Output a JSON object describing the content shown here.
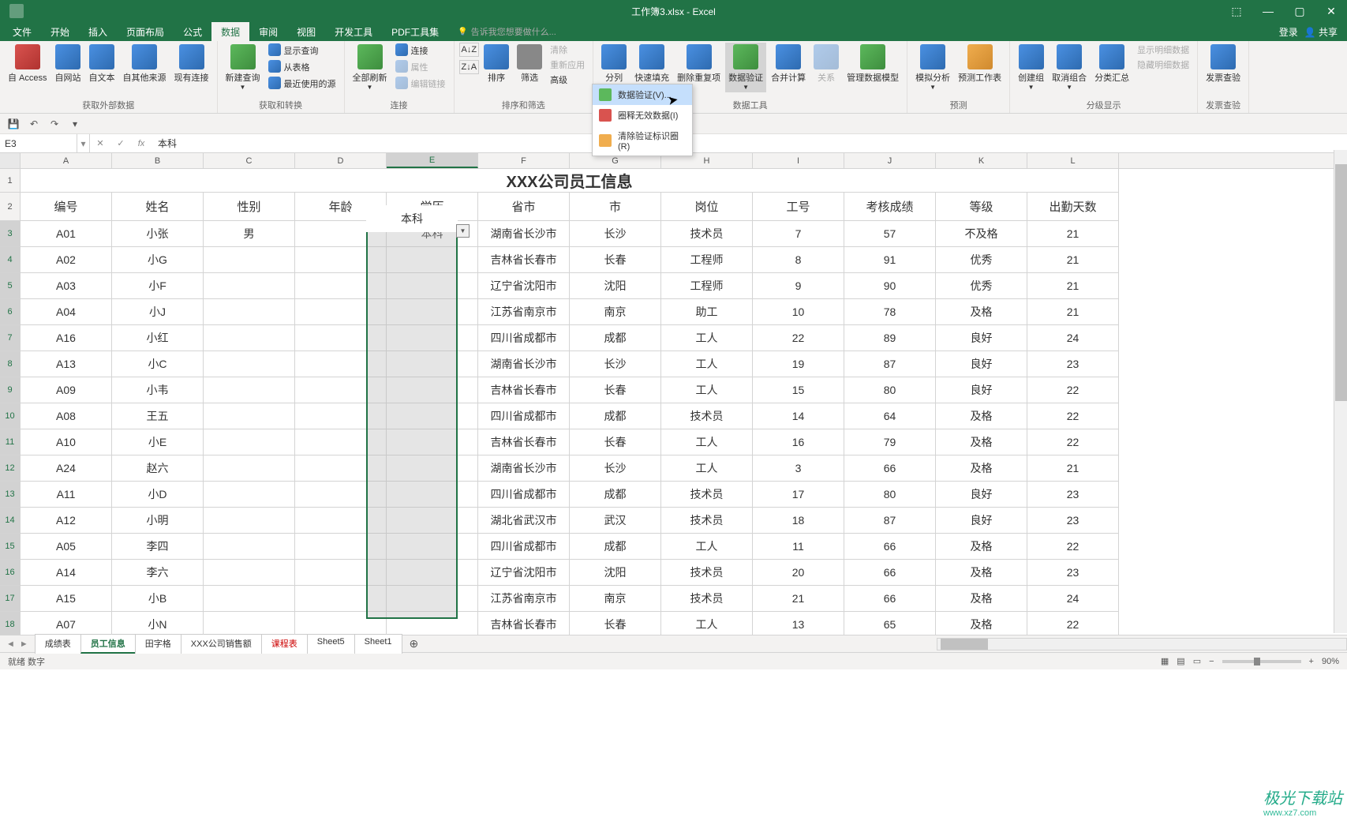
{
  "window": {
    "title": "工作簿3.xlsx - Excel"
  },
  "menubar": {
    "tabs": [
      "文件",
      "开始",
      "插入",
      "页面布局",
      "公式",
      "数据",
      "审阅",
      "视图",
      "开发工具",
      "PDF工具集"
    ],
    "active": "数据",
    "tellme": "告诉我您想要做什么...",
    "right": {
      "login": "登录",
      "share": "共享"
    }
  },
  "ribbon": {
    "groups": {
      "external": {
        "label": "获取外部数据",
        "items": [
          "自 Access",
          "自网站",
          "自文本",
          "自其他来源",
          "现有连接"
        ]
      },
      "transform": {
        "label": "获取和转换",
        "items": [
          "新建查询"
        ],
        "sub": [
          "显示查询",
          "从表格",
          "最近使用的源"
        ]
      },
      "connect": {
        "label": "连接",
        "items": [
          "全部刷新"
        ],
        "sub": [
          "连接",
          "属性",
          "编辑链接"
        ]
      },
      "sort": {
        "label": "排序和筛选",
        "items": [
          "排序",
          "筛选"
        ],
        "sub": [
          "清除",
          "重新应用",
          "高级"
        ],
        "az": "A↓Z",
        "za": "Z↓A"
      },
      "tools": {
        "label": "数据工具",
        "items": [
          "分列",
          "快速填充",
          "删除重复项",
          "数据验证",
          "合并计算",
          "关系",
          "管理数据模型"
        ]
      },
      "forecast": {
        "label": "预测",
        "items": [
          "模拟分析",
          "预测工作表"
        ]
      },
      "outline": {
        "label": "分级显示",
        "items": [
          "创建组",
          "取消组合",
          "分类汇总"
        ],
        "sub": [
          "显示明细数据",
          "隐藏明细数据"
        ]
      },
      "invoice": {
        "label": "发票查验",
        "items": [
          "发票查验"
        ]
      }
    }
  },
  "dropdown": {
    "items": [
      {
        "label": "数据验证(V)...",
        "hi": true
      },
      {
        "label": "圈释无效数据(I)"
      },
      {
        "label": "清除验证标识圈(R)"
      }
    ]
  },
  "formulabar": {
    "namebox": "E3",
    "value": "本科",
    "fx": "fx"
  },
  "grid": {
    "columns": [
      "A",
      "B",
      "C",
      "D",
      "E",
      "F",
      "G",
      "H",
      "I",
      "J",
      "K",
      "L"
    ],
    "selectedCol": "E",
    "title": "XXX公司员工信息",
    "headers": [
      "编号",
      "姓名",
      "性别",
      "年龄",
      "学历",
      "省市",
      "市",
      "岗位",
      "工号",
      "考核成绩",
      "等级",
      "出勤天数"
    ],
    "rows": [
      {
        "n": "3",
        "d": [
          "A01",
          "小张",
          "男",
          "",
          "本科",
          "湖南省长沙市",
          "长沙",
          "技术员",
          "7",
          "57",
          "不及格",
          "21"
        ]
      },
      {
        "n": "4",
        "d": [
          "A02",
          "小G",
          "",
          "",
          "",
          "吉林省长春市",
          "长春",
          "工程师",
          "8",
          "91",
          "优秀",
          "21"
        ]
      },
      {
        "n": "5",
        "d": [
          "A03",
          "小F",
          "",
          "",
          "",
          "辽宁省沈阳市",
          "沈阳",
          "工程师",
          "9",
          "90",
          "优秀",
          "21"
        ]
      },
      {
        "n": "6",
        "d": [
          "A04",
          "小J",
          "",
          "",
          "",
          "江苏省南京市",
          "南京",
          "助工",
          "10",
          "78",
          "及格",
          "21"
        ]
      },
      {
        "n": "7",
        "d": [
          "A16",
          "小红",
          "",
          "",
          "",
          "四川省成都市",
          "成都",
          "工人",
          "22",
          "89",
          "良好",
          "24"
        ]
      },
      {
        "n": "8",
        "d": [
          "A13",
          "小C",
          "",
          "",
          "",
          "湖南省长沙市",
          "长沙",
          "工人",
          "19",
          "87",
          "良好",
          "23"
        ]
      },
      {
        "n": "9",
        "d": [
          "A09",
          "小韦",
          "",
          "",
          "",
          "吉林省长春市",
          "长春",
          "工人",
          "15",
          "80",
          "良好",
          "22"
        ]
      },
      {
        "n": "10",
        "d": [
          "A08",
          "王五",
          "",
          "",
          "",
          "四川省成都市",
          "成都",
          "技术员",
          "14",
          "64",
          "及格",
          "22"
        ]
      },
      {
        "n": "11",
        "d": [
          "A10",
          "小E",
          "",
          "",
          "",
          "吉林省长春市",
          "长春",
          "工人",
          "16",
          "79",
          "及格",
          "22"
        ]
      },
      {
        "n": "12",
        "d": [
          "A24",
          "赵六",
          "",
          "",
          "",
          "湖南省长沙市",
          "长沙",
          "工人",
          "3",
          "66",
          "及格",
          "21"
        ]
      },
      {
        "n": "13",
        "d": [
          "A11",
          "小D",
          "",
          "",
          "",
          "四川省成都市",
          "成都",
          "技术员",
          "17",
          "80",
          "良好",
          "23"
        ]
      },
      {
        "n": "14",
        "d": [
          "A12",
          "小明",
          "",
          "",
          "",
          "湖北省武汉市",
          "武汉",
          "技术员",
          "18",
          "87",
          "良好",
          "23"
        ]
      },
      {
        "n": "15",
        "d": [
          "A05",
          "李四",
          "",
          "",
          "",
          "四川省成都市",
          "成都",
          "工人",
          "11",
          "66",
          "及格",
          "22"
        ]
      },
      {
        "n": "16",
        "d": [
          "A14",
          "李六",
          "",
          "",
          "",
          "辽宁省沈阳市",
          "沈阳",
          "技术员",
          "20",
          "66",
          "及格",
          "23"
        ]
      },
      {
        "n": "17",
        "d": [
          "A15",
          "小B",
          "",
          "",
          "",
          "江苏省南京市",
          "南京",
          "技术员",
          "21",
          "66",
          "及格",
          "24"
        ]
      },
      {
        "n": "18",
        "d": [
          "A07",
          "小N",
          "",
          "",
          "",
          "吉林省长春市",
          "长春",
          "工人",
          "13",
          "65",
          "及格",
          "22"
        ]
      }
    ]
  },
  "sheets": {
    "nav": [
      "◄",
      "►"
    ],
    "tabs": [
      {
        "label": "成绩表"
      },
      {
        "label": "员工信息",
        "active": true
      },
      {
        "label": "田字格"
      },
      {
        "label": "XXX公司销售额"
      },
      {
        "label": "课程表",
        "red": true
      },
      {
        "label": "Sheet5"
      },
      {
        "label": "Sheet1"
      }
    ],
    "add": "⊕"
  },
  "statusbar": {
    "left": "就绪    数字",
    "zoom": "90%"
  },
  "watermark": {
    "name": "极光下载站",
    "url": "www.xz7.com"
  }
}
